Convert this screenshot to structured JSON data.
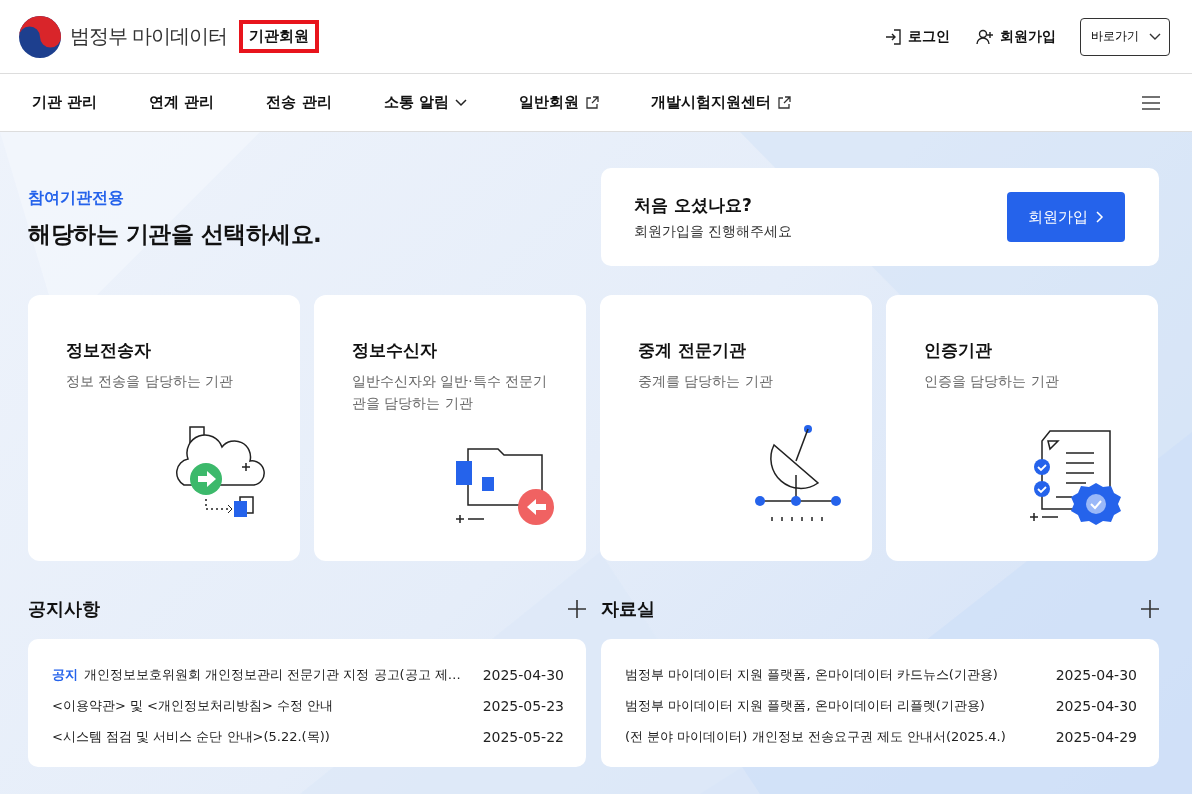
{
  "header": {
    "logo_text": "범정부 마이데이터",
    "member_type": "기관회원",
    "links": [
      {
        "label": "로그인",
        "kind": "login"
      },
      {
        "label": "회원가입",
        "kind": "signup"
      }
    ],
    "shortcut": "바로가기"
  },
  "nav": [
    {
      "label": "기관 관리",
      "kind": "plain"
    },
    {
      "label": "연계 관리",
      "kind": "plain"
    },
    {
      "label": "전송 관리",
      "kind": "plain"
    },
    {
      "label": "소통 알림",
      "kind": "dropdown"
    },
    {
      "label": "일반회원",
      "kind": "external"
    },
    {
      "label": "개발시험지원센터",
      "kind": "external"
    }
  ],
  "hero": {
    "eyebrow": "참여기관전용",
    "title": "해당하는 기관을 선택하세요."
  },
  "signup_card": {
    "title": "처음 오셨나요?",
    "text": "회원가입을 진행해주세요",
    "button": "회원가입"
  },
  "cards": [
    {
      "title": "정보전송자",
      "text": "정보 전송을 담당하는 기관"
    },
    {
      "title": "정보수신자",
      "text": "일반수신자와 일반·특수 전문기관을 담당하는 기관"
    },
    {
      "title": "중계 전문기관",
      "text": "중계를 담당하는 기관"
    },
    {
      "title": "인증기관",
      "text": "인증을 담당하는 기관"
    }
  ],
  "notices": {
    "title": "공지사항",
    "items": [
      {
        "tag": "공지",
        "title": "개인정보보호위원회 개인정보관리 전문기관 지정 공고(공고 제…",
        "date": "2025-04-30"
      },
      {
        "title": "<이용약관> 및 <개인정보처리방침> 수정 안내",
        "date": "2025-05-23"
      },
      {
        "title": "<시스템 점검 및 서비스 순단 안내>(5.22.(목))",
        "date": "2025-05-22"
      }
    ]
  },
  "archive": {
    "title": "자료실",
    "items": [
      {
        "title": "범정부 마이데이터 지원 플랫폼, 온마이데이터 카드뉴스(기관용)",
        "date": "2025-04-30"
      },
      {
        "title": "범정부 마이데이터 지원 플랫폼, 온마이데이터 리플렛(기관용)",
        "date": "2025-04-30"
      },
      {
        "title": "(전 분야 마이데이터) 개인정보 전송요구권 제도 안내서(2025.4.)",
        "date": "2025-04-29"
      }
    ]
  }
}
